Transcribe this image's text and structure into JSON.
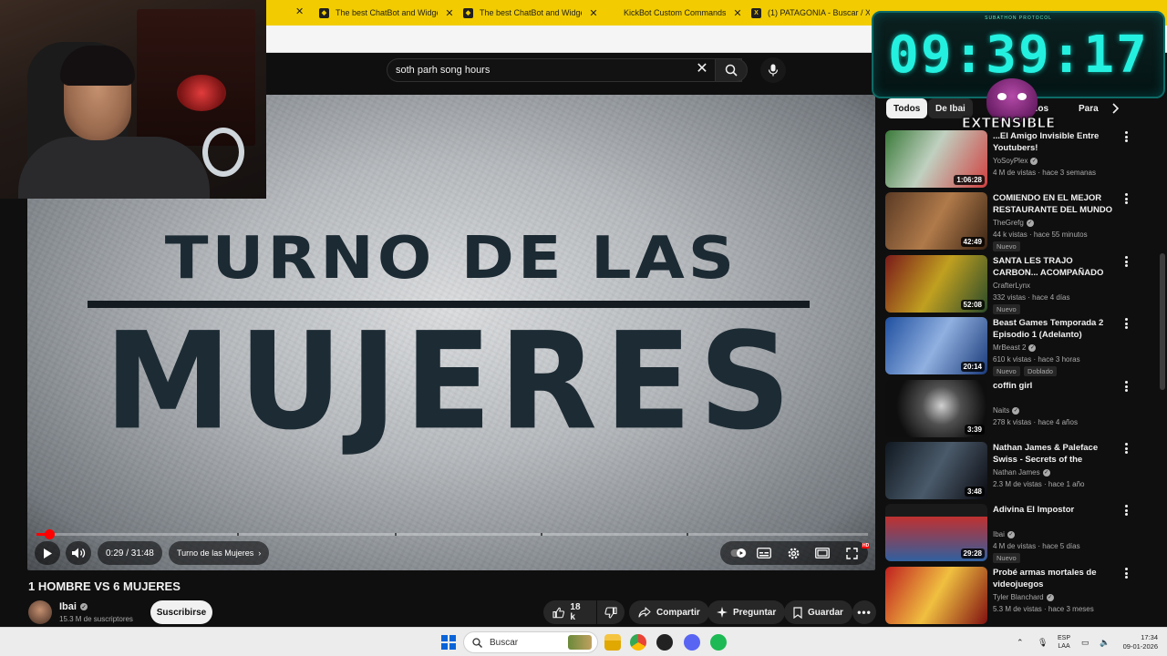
{
  "browser": {
    "tabs": [
      {
        "title": "The best ChatBot and Widgets",
        "icon": "widget-icon"
      },
      {
        "title": "The best ChatBot and Widgets",
        "icon": "widget-icon"
      },
      {
        "title": "KickBot Custom Commands",
        "icon": "kickbot-icon"
      },
      {
        "title": "(1) PATAGONIA - Buscar / X",
        "icon": "x-logo-icon"
      }
    ],
    "tab_bar_color": "#f2cc00"
  },
  "youtube": {
    "search_value": "soth parh song hours",
    "player": {
      "slide_line1": "TURNO DE LAS",
      "slide_line2": "MUJERES",
      "time_display": "0:29 / 31:48",
      "chapter": "Turno de las Mujeres",
      "progress_fraction": 0.0152
    },
    "video_title": "1 HOMBRE VS 6 MUJERES",
    "channel": {
      "name": "Ibai",
      "subscribers": "15.3 M de suscriptores"
    },
    "subscribe_label": "Suscribirse",
    "actions": {
      "likes": "18 k",
      "share": "Compartir",
      "ask": "Preguntar",
      "save": "Guardar"
    },
    "chips": [
      "Todos",
      "De Ibai",
      "...os",
      "Para"
    ],
    "recommendations": [
      {
        "title": "...El Amigo Invisible Entre Youtubers!",
        "channel": "YoSoyPlex",
        "verified": true,
        "meta": "4 M de vistas · hace 3 semanas",
        "duration": "1:06:28",
        "badges": [],
        "thumb": "linear-gradient(120deg,#3a7a3a,#c0d0c0 45%,#d04040)"
      },
      {
        "title": "COMIENDO EN EL MEJOR RESTAURANTE DEL MUNDO",
        "channel": "TheGrefg",
        "verified": true,
        "meta": "44 k vistas · hace 55 minutos",
        "duration": "42:49",
        "badges": [
          "Nuevo"
        ],
        "thumb": "linear-gradient(120deg,#5a3a24,#b07a4a 50%,#3a2414)"
      },
      {
        "title": "SANTA LES TRAJO CARBON... ACOMPAÑADO CON BRIM - T...",
        "channel": "CrafterLynx",
        "verified": false,
        "meta": "332 vistas · hace 4 días",
        "duration": "52:08",
        "badges": [
          "Nuevo"
        ],
        "thumb": "linear-gradient(120deg,#7a1a1a,#c0a020 50%,#2a4a2a)"
      },
      {
        "title": "Beast Games Temporada 2 Episodio 1 (Adelanto)",
        "channel": "MrBeast 2",
        "verified": true,
        "meta": "610 k vistas · hace 3 horas",
        "duration": "20:14",
        "badges": [
          "Nuevo",
          "Doblado"
        ],
        "thumb": "linear-gradient(120deg,#2050a0,#90b0e0 50%,#1a3a7a)"
      },
      {
        "title": "coffin girl",
        "channel": "Naits",
        "verified": true,
        "meta": "278 k vistas · hace 4 años",
        "duration": "3:39",
        "badges": [],
        "thumb": "radial-gradient(circle at 55% 45%,#d0d0d0 0%,#505050 30%,#0e0e0e 70%)"
      },
      {
        "title": "Nathan James & Paleface Swiss - Secrets of the Shadows ...",
        "channel": "Nathan James",
        "verified": true,
        "meta": "2.3 M de vistas · hace 1 año",
        "duration": "3:48",
        "badges": [],
        "thumb": "linear-gradient(120deg,#101820,#4a5a6a 50%,#0a0a10)"
      },
      {
        "title": "Adivina El Impostor",
        "channel": "Ibai",
        "verified": true,
        "meta": "4 M de vistas · hace 5 días",
        "duration": "29:28",
        "badges": [
          "Nuevo"
        ],
        "thumb": "linear-gradient(180deg,#1a1a1a 0 22%,#c03030 22%,#3060a0 100%)"
      },
      {
        "title": "Probé armas mortales de videojuegos",
        "channel": "Tyler Blanchard",
        "verified": true,
        "meta": "5.3 M de vistas · hace 3 meses",
        "duration": "",
        "badges": [],
        "thumb": "linear-gradient(120deg,#c02020,#f0c040 50%,#801010)"
      }
    ]
  },
  "overlay": {
    "timer_caption": "SUBATHON PROTOCOL",
    "timer": "09:39:17",
    "label": "EXTENSIBLE",
    "accent": "#24f0e0"
  },
  "taskbar": {
    "search_placeholder": "Buscar",
    "lang_top": "ESP",
    "lang_bottom": "LAA",
    "time": "17:34",
    "date": "09-01-2026"
  }
}
